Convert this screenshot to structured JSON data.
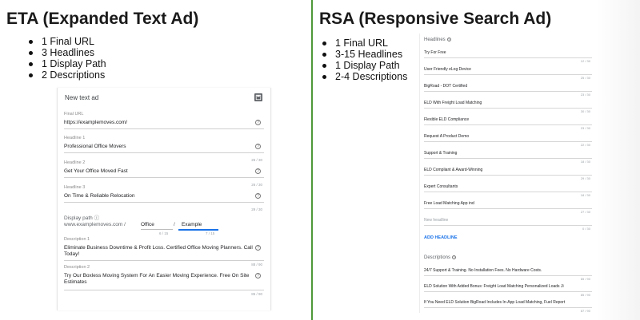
{
  "eta": {
    "heading": "ETA (Expanded Text Ad)",
    "bullets": [
      "1 Final URL",
      "3 Headlines",
      "1 Display Path",
      "2 Descriptions"
    ],
    "form": {
      "title": "New text ad",
      "final_url_label": "Final URL",
      "final_url_value": "https://examplemoves.com/",
      "headline1_label": "Headline 1",
      "headline1_value": "Professional Office Movers",
      "headline1_count": "",
      "headline2_label": "Headline 2",
      "headline2_value": "Get Your Office Moved Fast",
      "headline2_count": "26 / 30",
      "headline3_label": "Headline 3",
      "headline3_value": "On Time & Reliable Relocation",
      "headline3_count": "26 / 30",
      "display_path_label": "Display path ⓘ",
      "display_path_url": "www.examplemoves.com /",
      "path1_value": "Office",
      "path_separator": "/",
      "path2_value": "Example",
      "display_path_count": "29 / 30",
      "path1_count": "6 / 15",
      "path2_count": "7 / 15",
      "description1_label": "Description 1",
      "description1_value": "Eliminate Business Downtime & Profit Loss. Certified Office Moving Planners. Call Today!",
      "description2_label": "Description 2",
      "description2_value": "Try Our Boxless Moving System For An Easier Moving Experience. Free On Site Estimates",
      "description1_count": "88 / 90",
      "description2_count": "85 / 90"
    }
  },
  "rsa": {
    "heading": "RSA (Responsive Search Ad)",
    "bullets": [
      "1 Final URL",
      "3-15 Headlines",
      "1 Display Path",
      "2-4 Descriptions"
    ],
    "headlines_label": "Headlines",
    "headlines": [
      {
        "text": "Try For Free",
        "count": "12 / 30"
      },
      {
        "text": "User Friendly eLog Device",
        "count": "25 / 30"
      },
      {
        "text": "BigRoad - DOT Certified",
        "count": "23 / 30"
      },
      {
        "text": "ELD With Freight Load Matching",
        "count": "30 / 30"
      },
      {
        "text": "Flexible ELD Compliance",
        "count": "23 / 30"
      },
      {
        "text": "Request A Product Demo",
        "count": "22 / 30"
      },
      {
        "text": "Support & Training",
        "count": "18 / 30"
      },
      {
        "text": "ELD Compliant & Award-Winning",
        "count": "29 / 30"
      },
      {
        "text": "Expert Consultants",
        "count": "18 / 30"
      },
      {
        "text": "Free Load Matching App incl",
        "count": "27 / 30"
      }
    ],
    "new_headline_placeholder": "New headline",
    "new_headline_count": "0 / 30",
    "add_headline_label": "ADD HEADLINE",
    "descriptions_label": "Descriptions",
    "descriptions": [
      {
        "text": "24/7 Support & Training. No Installation Fees. No Hardware Costs.",
        "count": "65 / 90"
      },
      {
        "text": "ELD Solution With Added Bonus: Freight Load Matching Personalized Loads Ji",
        "count": "85 / 90"
      },
      {
        "text": "If You Need ELD Solution BigRoad Includes In-App Load Matching, Fuel Report",
        "count": "87 / 90"
      }
    ]
  },
  "colors": {
    "divider": "#4e9a3a",
    "link": "#1a73e8",
    "label_grey": "#8a8a8a"
  }
}
